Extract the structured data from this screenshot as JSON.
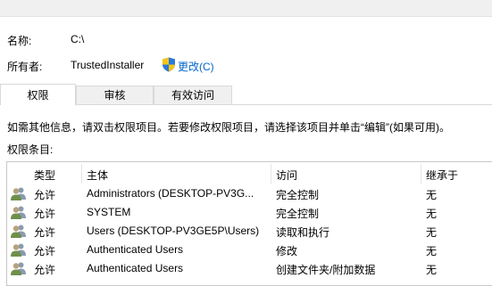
{
  "owner_section": {
    "name_label": "名称:",
    "name_value": "C:\\",
    "owner_label": "所有者:",
    "owner_value": "TrustedInstaller",
    "change_link": "更改(C)"
  },
  "tabs": [
    {
      "label": "权限",
      "active": true
    },
    {
      "label": "审核",
      "active": false
    },
    {
      "label": "有效访问",
      "active": false
    }
  ],
  "info_text": "如需其他信息，请双击权限项目。若要修改权限项目，请选择该项目并单击“编辑”(如果可用)。",
  "entries_label": "权限条目:",
  "table": {
    "headers": [
      "类型",
      "主体",
      "访问",
      "继承于"
    ],
    "rows": [
      {
        "type": "允许",
        "principal": "Administrators (DESKTOP-PV3G...",
        "access": "完全控制",
        "inherited": "无"
      },
      {
        "type": "允许",
        "principal": "SYSTEM",
        "access": "完全控制",
        "inherited": "无"
      },
      {
        "type": "允许",
        "principal": "Users (DESKTOP-PV3GE5P\\Users)",
        "access": "读取和执行",
        "inherited": "无"
      },
      {
        "type": "允许",
        "principal": "Authenticated Users",
        "access": "修改",
        "inherited": "无"
      },
      {
        "type": "允许",
        "principal": "Authenticated Users",
        "access": "创建文件夹/附加数据",
        "inherited": "无"
      }
    ]
  },
  "icons": {
    "shield": "uac-shield-icon",
    "principal": "users-group-icon"
  },
  "colors": {
    "link": "#0066cc",
    "tab_inactive_bg": "#f0f0f0",
    "border": "#d9d9d9"
  }
}
